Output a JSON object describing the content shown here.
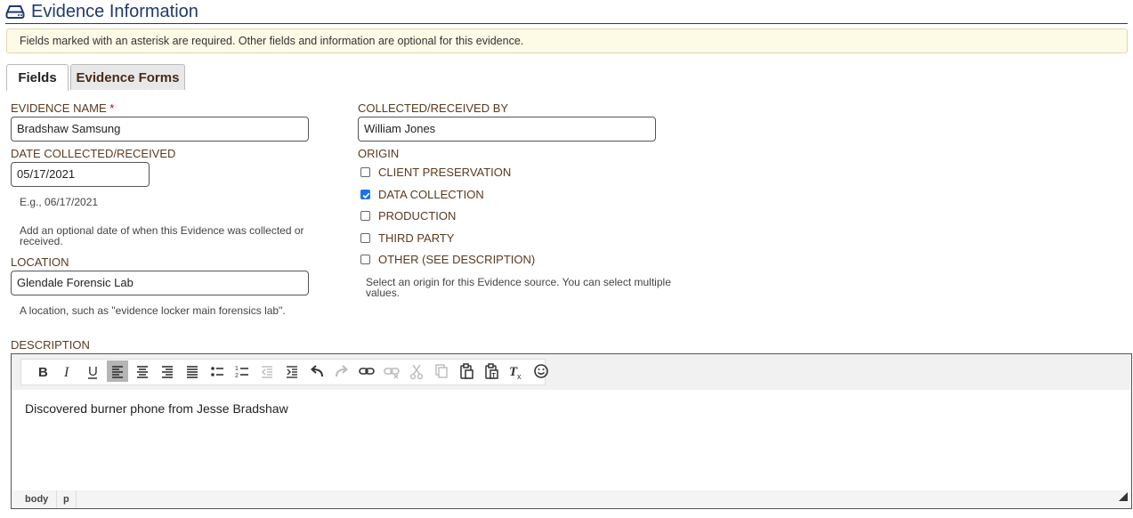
{
  "header": {
    "title": "Evidence Information",
    "icon": "hard-drive-icon",
    "color": "#1f3a6e"
  },
  "notice": "Fields marked with an asterisk are required. Other fields and information are optional for this evidence.",
  "tabs": [
    {
      "label": "Fields",
      "active": true
    },
    {
      "label": "Evidence Forms",
      "active": false
    }
  ],
  "form": {
    "evidence_name": {
      "label": "EVIDENCE NAME",
      "required_mark": "*",
      "value": "Bradshaw Samsung"
    },
    "collected_by": {
      "label": "COLLECTED/RECEIVED BY",
      "value": "William Jones"
    },
    "date": {
      "label": "DATE COLLECTED/RECEIVED",
      "value": "05/17/2021",
      "example": "E.g., 06/17/2021",
      "help_line1": "Add an optional date of when this Evidence was collected or",
      "help_line2": "received."
    },
    "location": {
      "label": "LOCATION",
      "value": "Glendale Forensic Lab",
      "help": "A location, such as \"evidence locker main forensics lab\"."
    },
    "origin": {
      "label": "ORIGIN",
      "options": [
        {
          "label": "CLIENT PRESERVATION",
          "checked": false
        },
        {
          "label": "DATA COLLECTION",
          "checked": true
        },
        {
          "label": "PRODUCTION",
          "checked": false
        },
        {
          "label": "THIRD PARTY",
          "checked": false
        },
        {
          "label": "OTHER (SEE DESCRIPTION)",
          "checked": false
        }
      ],
      "help_line1": "Select an origin for this Evidence source. You can select multiple",
      "help_line2": "values."
    },
    "description": {
      "label": "DESCRIPTION",
      "content": "Discovered burner phone from Jesse Bradshaw",
      "toolbar": [
        "bold",
        "italic",
        "underline",
        "align-left",
        "align-center",
        "align-right",
        "align-justify",
        "bullet-list",
        "numbered-list",
        "outdent",
        "indent",
        "undo",
        "redo",
        "link",
        "unlink",
        "cut",
        "copy",
        "paste",
        "paste-text",
        "clear-format",
        "emoji"
      ],
      "active_tool": "align-left",
      "statusbar_path": [
        "body",
        "p"
      ]
    }
  },
  "colors": {
    "accent": "#1f3a6e",
    "label": "#5a3a20",
    "notice_bg": "#fdfae6",
    "checkbox_checked": "#1a73e8",
    "required": "#cc0000"
  }
}
